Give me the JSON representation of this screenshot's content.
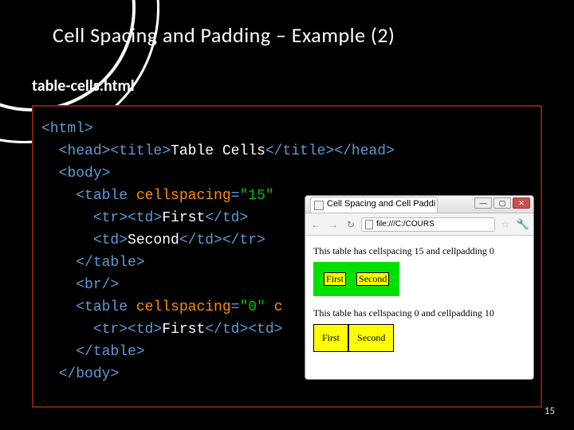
{
  "slide": {
    "title": "Cell Spacing and Padding – Example (2)",
    "subtitle": "table-cells.html",
    "page_number": "15"
  },
  "code": {
    "l1a": "<html>",
    "l2a": "<head><title>",
    "l2b": "Table Cells",
    "l2c": "</title></head>",
    "l3a": "<body>",
    "l4a": "<table ",
    "l4attr": "cellspacing",
    "l4eq": "=",
    "l4val": "\"15\"",
    "l5a": "<tr><td>",
    "l5b": "First",
    "l5c": "</td>",
    "l6a": "<td>",
    "l6b": "Second",
    "l6c": "</td></tr>",
    "l7a": "</table>",
    "l8a": "<br/>",
    "l9a": "<table ",
    "l9attr": "cellspacing",
    "l9eq": "=",
    "l9val": "\"0\"",
    "l9rest": " c",
    "l10a": "<tr><td>",
    "l10b": "First",
    "l10c": "</td><td>",
    "l11a": "</table>",
    "l12a": "</body>"
  },
  "browser": {
    "tab_title": "Cell Spacing and Cell Paddi",
    "win_min": "—",
    "win_max": "▢",
    "win_close": "✕",
    "nav_back": "←",
    "nav_fwd": "→",
    "nav_reload": "↻",
    "address": "file:///C:/COURS",
    "star": "☆",
    "wrench": "🔧",
    "caption1": "This table has cellspacing 15 and cellpadding 0",
    "caption2": "This table has cellspacing 0 and cellpadding 10",
    "cell1": "First",
    "cell2": "Second"
  }
}
